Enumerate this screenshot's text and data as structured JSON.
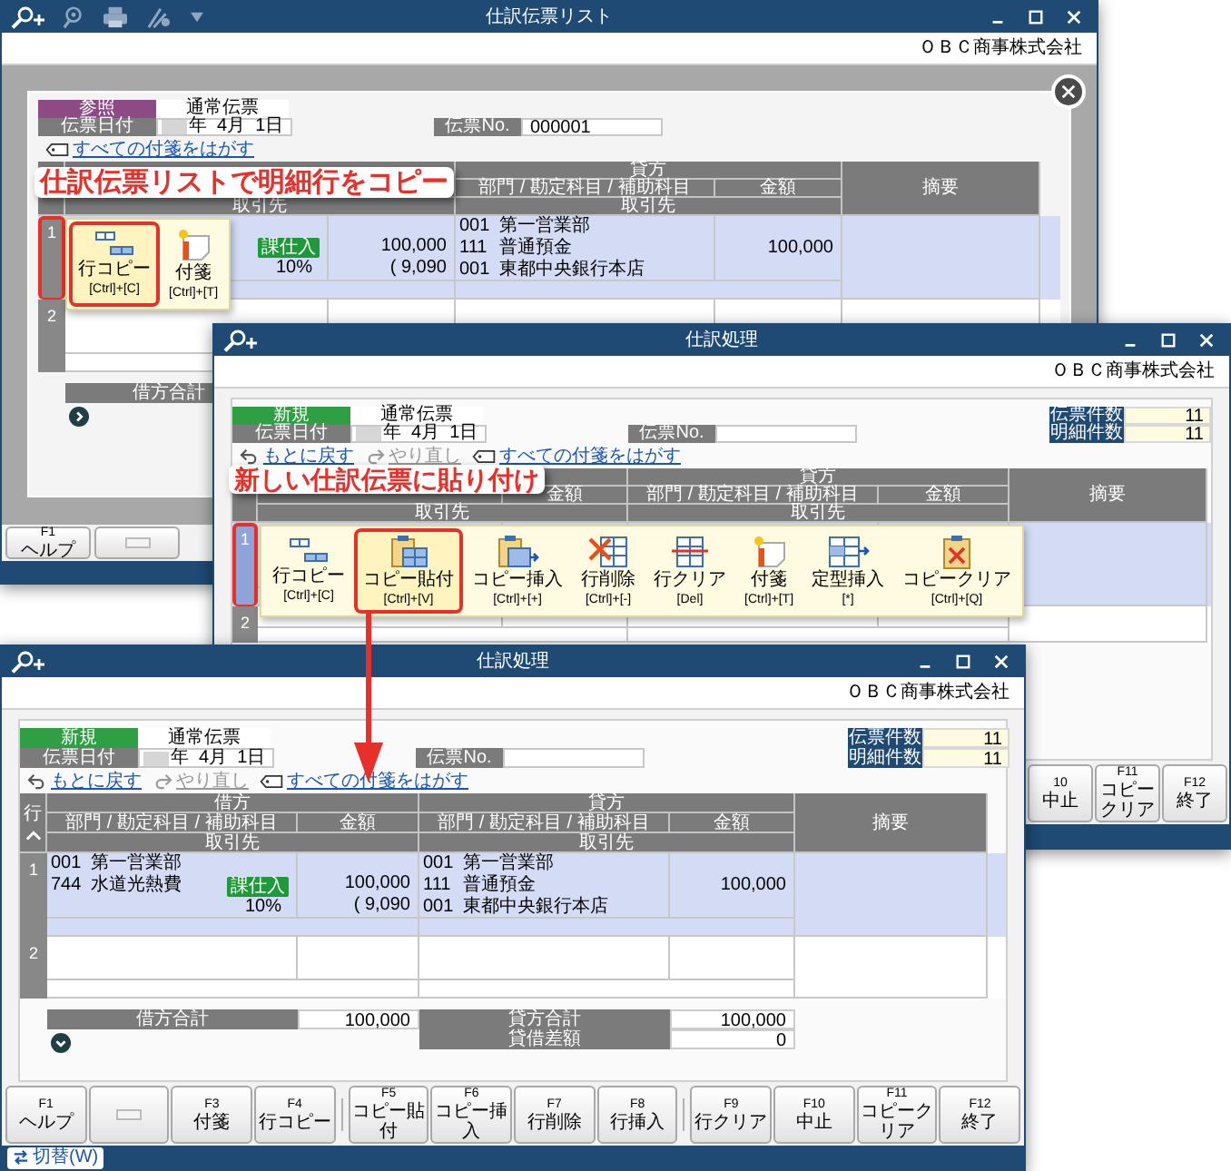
{
  "windows": [
    {
      "kind": "list",
      "title": "仕訳伝票リスト",
      "company": "ＯＢＣ商事株式会社",
      "form": {
        "mode": {
          "label": "参照",
          "kind": "reference"
        },
        "voucher_type": "通常伝票",
        "date_label": "伝票日付",
        "date": "年  4月  1日",
        "number_label": "伝票No.",
        "number": "000001",
        "links": [
          {
            "kind": "tag",
            "label": "すべての付箋をはがす",
            "disabled": false
          }
        ],
        "table": {
          "header": {
            "debit_partner": "取引先",
            "credit": "貸方",
            "credit_account": "部門 / 勘定科目 / 補助科目",
            "credit_amount": "金額",
            "credit_partner": "取引先",
            "memo": "摘要"
          },
          "rows": [
            {
              "number": "1",
              "selected": true,
              "focused": false,
              "highlighted": true,
              "tax": "課仕入",
              "debit_amount": "100,000",
              "tax_rate": "10%",
              "tax_amount": "( 9,090",
              "credit_lines": [
                {
                  "code": "001",
                  "name": "第一営業部"
                },
                {
                  "code": "111",
                  "name": "普通預金"
                },
                {
                  "code": "001",
                  "name": "東都中央銀行本店"
                }
              ],
              "credit_amount": "100,000"
            },
            {
              "number": "2",
              "selected": false,
              "focused": false,
              "highlighted": false
            }
          ]
        },
        "context_menu": [
          {
            "kind": "copy-row",
            "label": "行コピー",
            "shortcut": "[Ctrl]+[C]",
            "highlighted": true
          },
          {
            "kind": "sticky-note",
            "label": "付箋",
            "shortcut": "[Ctrl]+[T]",
            "highlighted": false
          }
        ],
        "callout": "仕訳伝票リストで明細行をコピー",
        "totals": {
          "expanded": false,
          "debit_label": "借方合計"
        }
      },
      "function_keys": [
        {
          "kind": "key",
          "key": "F1",
          "label": "ヘルプ"
        },
        {
          "kind": "blank"
        }
      ]
    },
    {
      "kind": "entry",
      "title": "仕訳処理",
      "company": "ＯＢＣ商事株式会社",
      "form": {
        "mode": {
          "label": "新規",
          "kind": "new"
        },
        "voucher_type": "通常伝票",
        "date_label": "伝票日付",
        "date": "年  4月  1日",
        "number_label": "伝票No.",
        "counts": [
          {
            "label": "伝票件数",
            "value": "11"
          },
          {
            "label": "明細件数",
            "value": "11"
          }
        ],
        "links": [
          {
            "kind": "undo",
            "label": "もとに戻す",
            "disabled": false
          },
          {
            "kind": "redo",
            "label": "やり直し",
            "disabled": true
          },
          {
            "kind": "tag",
            "label": "すべての付箋をはがす",
            "disabled": false
          }
        ],
        "table": {
          "header": {
            "debit_amount": "金額",
            "debit_partner": "取引先",
            "credit": "貸方",
            "credit_account": "部門 / 勘定科目 / 補助科目",
            "credit_amount": "金額",
            "credit_partner": "取引先",
            "memo": "摘要"
          },
          "rows": [
            {
              "number": "1",
              "selected": true,
              "focused": true,
              "highlighted": true
            },
            {
              "number": "2",
              "selected": false,
              "focused": false,
              "highlighted": false
            }
          ]
        },
        "context_menu": [
          {
            "kind": "copy-row",
            "label": "行コピー",
            "shortcut": "[Ctrl]+[C]",
            "highlighted": false
          },
          {
            "kind": "paste",
            "label": "コピー貼付",
            "shortcut": "[Ctrl]+[V]",
            "highlighted": true
          },
          {
            "kind": "insert-copy",
            "label": "コピー挿入",
            "shortcut": "[Ctrl]+[+]",
            "highlighted": false
          },
          {
            "kind": "delete-row",
            "label": "行削除",
            "shortcut": "[Ctrl]+[-]",
            "highlighted": false
          },
          {
            "kind": "clear-row",
            "label": "行クリア",
            "shortcut": "[Del]",
            "highlighted": false
          },
          {
            "kind": "sticky-note",
            "label": "付箋",
            "shortcut": "[Ctrl]+[T]",
            "highlighted": false
          },
          {
            "kind": "template-insert",
            "label": "定型挿入",
            "shortcut": "[*]",
            "highlighted": false
          },
          {
            "kind": "clear-copy",
            "label": "コピークリア",
            "shortcut": "[Ctrl]+[Q]",
            "highlighted": false
          }
        ],
        "callout": "新しい仕訳伝票に貼り付け"
      },
      "function_keys": [
        {
          "kind": "key",
          "key": "10",
          "label": "中止"
        },
        {
          "kind": "key",
          "key": "F11",
          "label": "コピークリア"
        },
        {
          "kind": "key",
          "key": "F12",
          "label": "終了"
        }
      ]
    },
    {
      "kind": "entry",
      "title": "仕訳処理",
      "company": "ＯＢＣ商事株式会社",
      "form": {
        "mode": {
          "label": "新規",
          "kind": "new"
        },
        "voucher_type": "通常伝票",
        "date_label": "伝票日付",
        "date": "年  4月  1日",
        "number_label": "伝票No.",
        "counts": [
          {
            "label": "伝票件数",
            "value": "11"
          },
          {
            "label": "明細件数",
            "value": "11"
          }
        ],
        "links": [
          {
            "kind": "undo",
            "label": "もとに戻す",
            "disabled": false
          },
          {
            "kind": "redo",
            "label": "やり直し",
            "disabled": true
          },
          {
            "kind": "tag",
            "label": "すべての付箋をはがす",
            "disabled": false
          }
        ],
        "table": {
          "header": {
            "row": "行",
            "debit": "借方",
            "debit_account": "部門 / 勘定科目 / 補助科目",
            "debit_amount": "金額",
            "debit_partner": "取引先",
            "credit": "貸方",
            "credit_account": "部門 / 勘定科目 / 補助科目",
            "credit_amount": "金額",
            "credit_partner": "取引先",
            "memo": "摘要"
          },
          "rows": [
            {
              "number": "1",
              "selected": true,
              "focused": false,
              "highlighted": false,
              "debit_lines": [
                {
                  "code": "001",
                  "name": "第一営業部"
                },
                {
                  "code": "744",
                  "name": "水道光熱費"
                }
              ],
              "tax": "課仕入",
              "debit_amount": "100,000",
              "tax_rate": "10%",
              "tax_amount": "( 9,090",
              "credit_lines": [
                {
                  "code": "001",
                  "name": "第一営業部"
                },
                {
                  "code": "111",
                  "name": "普通預金"
                },
                {
                  "code": "001",
                  "name": "東都中央銀行本店"
                }
              ],
              "credit_amount": "100,000"
            },
            {
              "number": "2",
              "selected": false,
              "focused": false,
              "highlighted": false
            }
          ]
        },
        "totals": {
          "expanded": true,
          "debit_label": "借方合計",
          "debit_total": "100,000",
          "credit_label": "貸方合計",
          "credit_total": "100,000",
          "diff_label": "貸借差額",
          "diff": "0"
        }
      },
      "function_keys": [
        {
          "kind": "key",
          "key": "F1",
          "label": "ヘルプ"
        },
        {
          "kind": "blank"
        },
        {
          "kind": "key",
          "key": "F3",
          "label": "付箋"
        },
        {
          "kind": "key",
          "key": "F4",
          "label": "行コピー"
        },
        {
          "kind": "separator"
        },
        {
          "kind": "key",
          "key": "F5",
          "label": "コピー貼付"
        },
        {
          "kind": "key",
          "key": "F6",
          "label": "コピー挿入"
        },
        {
          "kind": "key",
          "key": "F7",
          "label": "行削除"
        },
        {
          "kind": "key",
          "key": "F8",
          "label": "行挿入"
        },
        {
          "kind": "separator"
        },
        {
          "kind": "key",
          "key": "F9",
          "label": "行クリア"
        },
        {
          "kind": "key",
          "key": "F10",
          "label": "中止"
        },
        {
          "kind": "key",
          "key": "F11",
          "label": "コピークリア"
        },
        {
          "kind": "key",
          "key": "F12",
          "label": "終了"
        }
      ],
      "status_bar": {
        "switch_button": "切替(W)"
      }
    }
  ]
}
